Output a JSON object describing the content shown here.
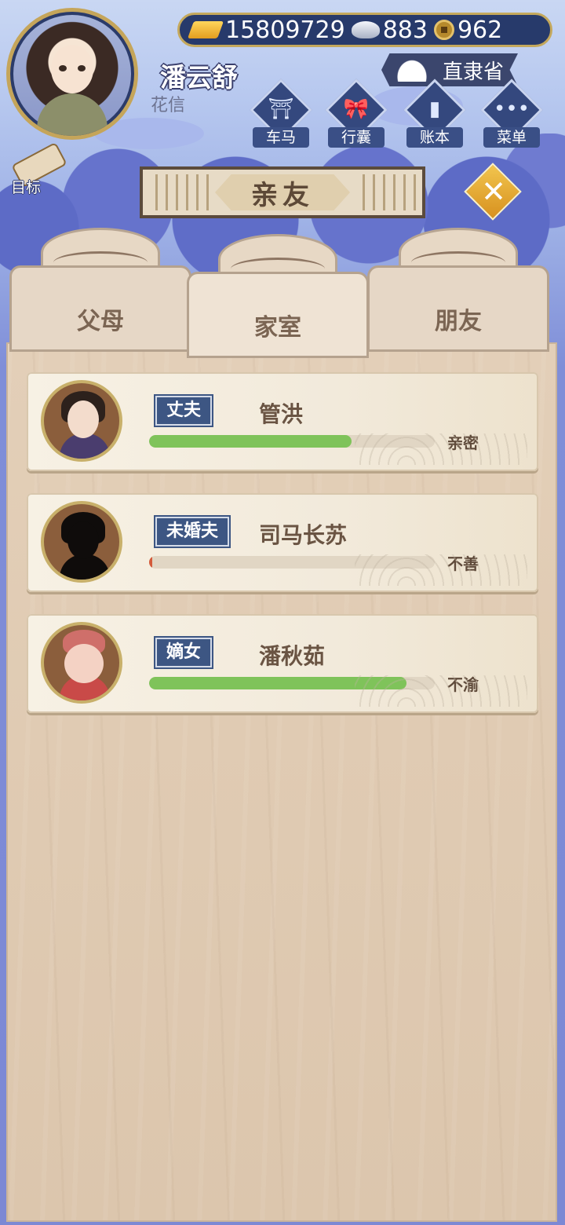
{
  "player": {
    "name": "潘云舒",
    "sub": "花信"
  },
  "currency": {
    "gold": "15809729",
    "silver": "883",
    "coin": "962"
  },
  "location": "直隶省",
  "menu": [
    {
      "label": "车马",
      "icon": "carriage-icon"
    },
    {
      "label": "行囊",
      "icon": "bundle-icon"
    },
    {
      "label": "账本",
      "icon": "ledger-icon"
    },
    {
      "label": "菜单",
      "icon": "more-icon"
    }
  ],
  "goal": {
    "label": "目标"
  },
  "title": "亲友",
  "tabs": [
    {
      "label": "父母"
    },
    {
      "label": "家室"
    },
    {
      "label": "朋友"
    }
  ],
  "active_tab": 1,
  "relations": [
    {
      "role": "丈夫",
      "name": "管洪",
      "status": "亲密",
      "affinity": 0.71
    },
    {
      "role": "未婚夫",
      "name": "司马长苏",
      "status": "不善",
      "affinity": 0.01
    },
    {
      "role": "嫡女",
      "name": "潘秋茹",
      "status": "不渝",
      "affinity": 0.9
    }
  ],
  "colors": {
    "bar_fill": "#7fc35a",
    "role_badge": "#3d5683",
    "accent_gold": "#c4a85c"
  }
}
